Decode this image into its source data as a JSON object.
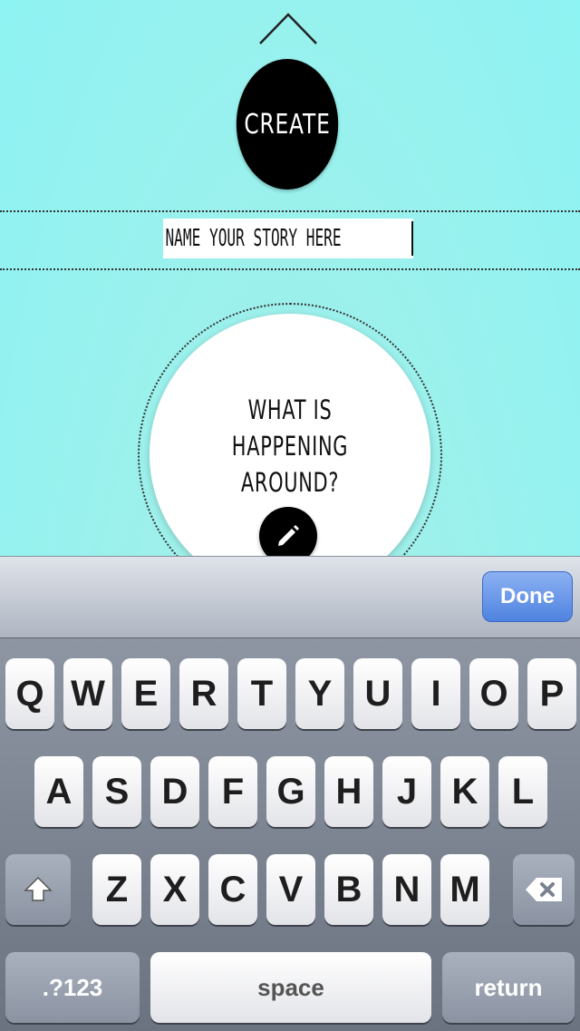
{
  "create_label": "CREATE",
  "story_title": {
    "value": "NAME YOUR STORY HERE"
  },
  "prompt": {
    "line1": "WHAT IS HAPPENING",
    "line2": "AROUND?"
  },
  "keyboard": {
    "done_label": "Done",
    "row1": [
      "Q",
      "W",
      "E",
      "R",
      "T",
      "Y",
      "U",
      "I",
      "O",
      "P"
    ],
    "row2": [
      "A",
      "S",
      "D",
      "F",
      "G",
      "H",
      "J",
      "K",
      "L"
    ],
    "row3": [
      "Z",
      "X",
      "C",
      "V",
      "B",
      "N",
      "M"
    ],
    "numbers_label": ".?123",
    "space_label": "space",
    "return_label": "return"
  },
  "icons": {
    "collapse": "chevron-up-icon",
    "edit": "pencil-icon",
    "shift": "shift-icon",
    "backspace": "backspace-icon"
  },
  "colors": {
    "background": "#8ef3f3",
    "accent": "#000000",
    "done": "#4f83e0"
  }
}
